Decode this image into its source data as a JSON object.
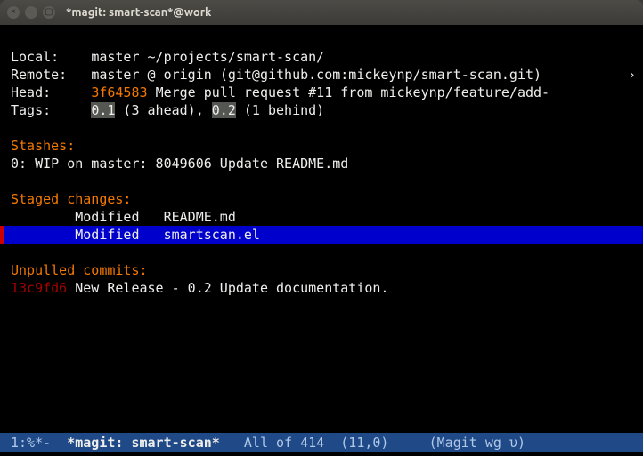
{
  "window": {
    "title": "*magit: smart-scan*@work",
    "buttons": {
      "close": "×",
      "min": "–",
      "max": "▢"
    }
  },
  "header": {
    "local": {
      "label": "Local:",
      "branch": "master",
      "path": "~/projects/smart-scan/"
    },
    "remote": {
      "label": "Remote:",
      "branch": "master",
      "at": "@ origin",
      "url": "(git@github.com:mickeynp/smart-scan.git)"
    },
    "head": {
      "label": "Head:",
      "sha": "3f64583",
      "msg": "Merge pull request #11 from mickeynp/feature/add-",
      "overflow": "›"
    },
    "tags": {
      "label": "Tags:",
      "t1": "0.1",
      "t1s": " (3 ahead), ",
      "t2": "0.2",
      "t2s": " (1 behind)"
    }
  },
  "stashes": {
    "heading": "Stashes:",
    "items": [
      {
        "idx": "0",
        "text": ": WIP on master: 8049606 Update README.md"
      }
    ]
  },
  "staged": {
    "heading": "Staged changes:",
    "items": [
      {
        "state": "Modified",
        "file": "README.md",
        "selected": false
      },
      {
        "state": "Modified",
        "file": "smartscan.el",
        "selected": true
      }
    ]
  },
  "unpulled": {
    "heading": "Unpulled commits:",
    "items": [
      {
        "sha": "13c9fd6",
        "msg": "New Release - 0.2 Update documentation."
      }
    ]
  },
  "modeline": {
    "left": "1:%*-  ",
    "buffer": "*magit: smart-scan*",
    "pos": "   All of 414  (11,0)     ",
    "mode": "(Magit wg υ)"
  }
}
